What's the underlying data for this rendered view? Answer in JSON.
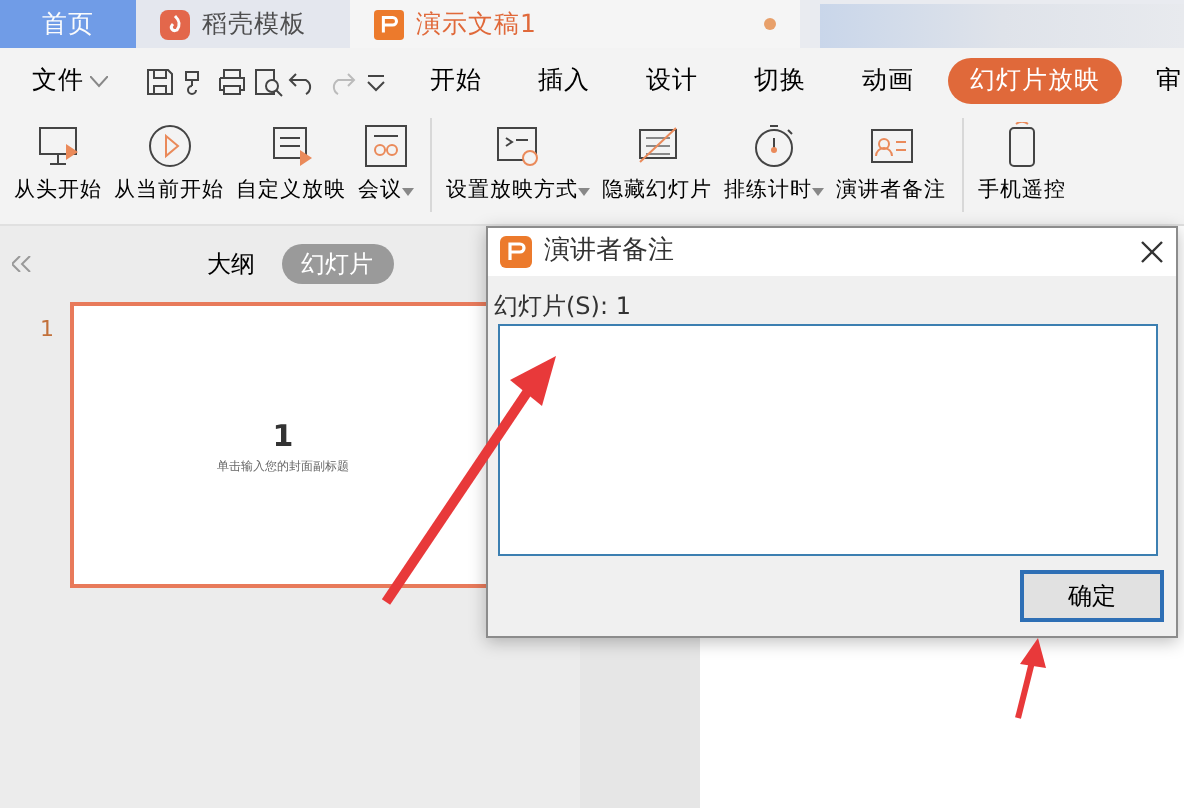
{
  "tabs": [
    {
      "label": "首页",
      "selected": false,
      "kind": "home"
    },
    {
      "label": "稻壳模板",
      "selected": false,
      "kind": "docer"
    },
    {
      "label": "演示文稿1",
      "selected": true,
      "kind": "doc"
    }
  ],
  "menu": {
    "file": "文件",
    "tabs": [
      {
        "label": "开始",
        "selected": false
      },
      {
        "label": "插入",
        "selected": false
      },
      {
        "label": "设计",
        "selected": false
      },
      {
        "label": "切换",
        "selected": false
      },
      {
        "label": "动画",
        "selected": false
      },
      {
        "label": "幻灯片放映",
        "selected": true
      },
      {
        "label": "审",
        "selected": false
      }
    ]
  },
  "ribbon": [
    {
      "label": "从头开始",
      "dropdown": false,
      "group_end": false
    },
    {
      "label": "从当前开始",
      "dropdown": false,
      "group_end": false
    },
    {
      "label": "自定义放映",
      "dropdown": false,
      "group_end": false
    },
    {
      "label": "会议",
      "dropdown": true,
      "group_end": true
    },
    {
      "label": "设置放映方式",
      "dropdown": true,
      "group_end": false
    },
    {
      "label": "隐藏幻灯片",
      "dropdown": false,
      "group_end": false
    },
    {
      "label": "排练计时",
      "dropdown": true,
      "group_end": false
    },
    {
      "label": "演讲者备注",
      "dropdown": false,
      "group_end": true
    },
    {
      "label": "手机遥控",
      "dropdown": false,
      "group_end": false
    }
  ],
  "panel": {
    "tabs": [
      {
        "label": "大纲",
        "selected": false
      },
      {
        "label": "幻灯片",
        "selected": true
      }
    ],
    "slides": [
      {
        "number": "1",
        "title": "1",
        "subtitle": "单击输入您的封面副标题",
        "selected": true
      }
    ]
  },
  "dialog": {
    "title": "演讲者备注",
    "field_label": "幻灯片(S): 1",
    "button": "确定"
  }
}
